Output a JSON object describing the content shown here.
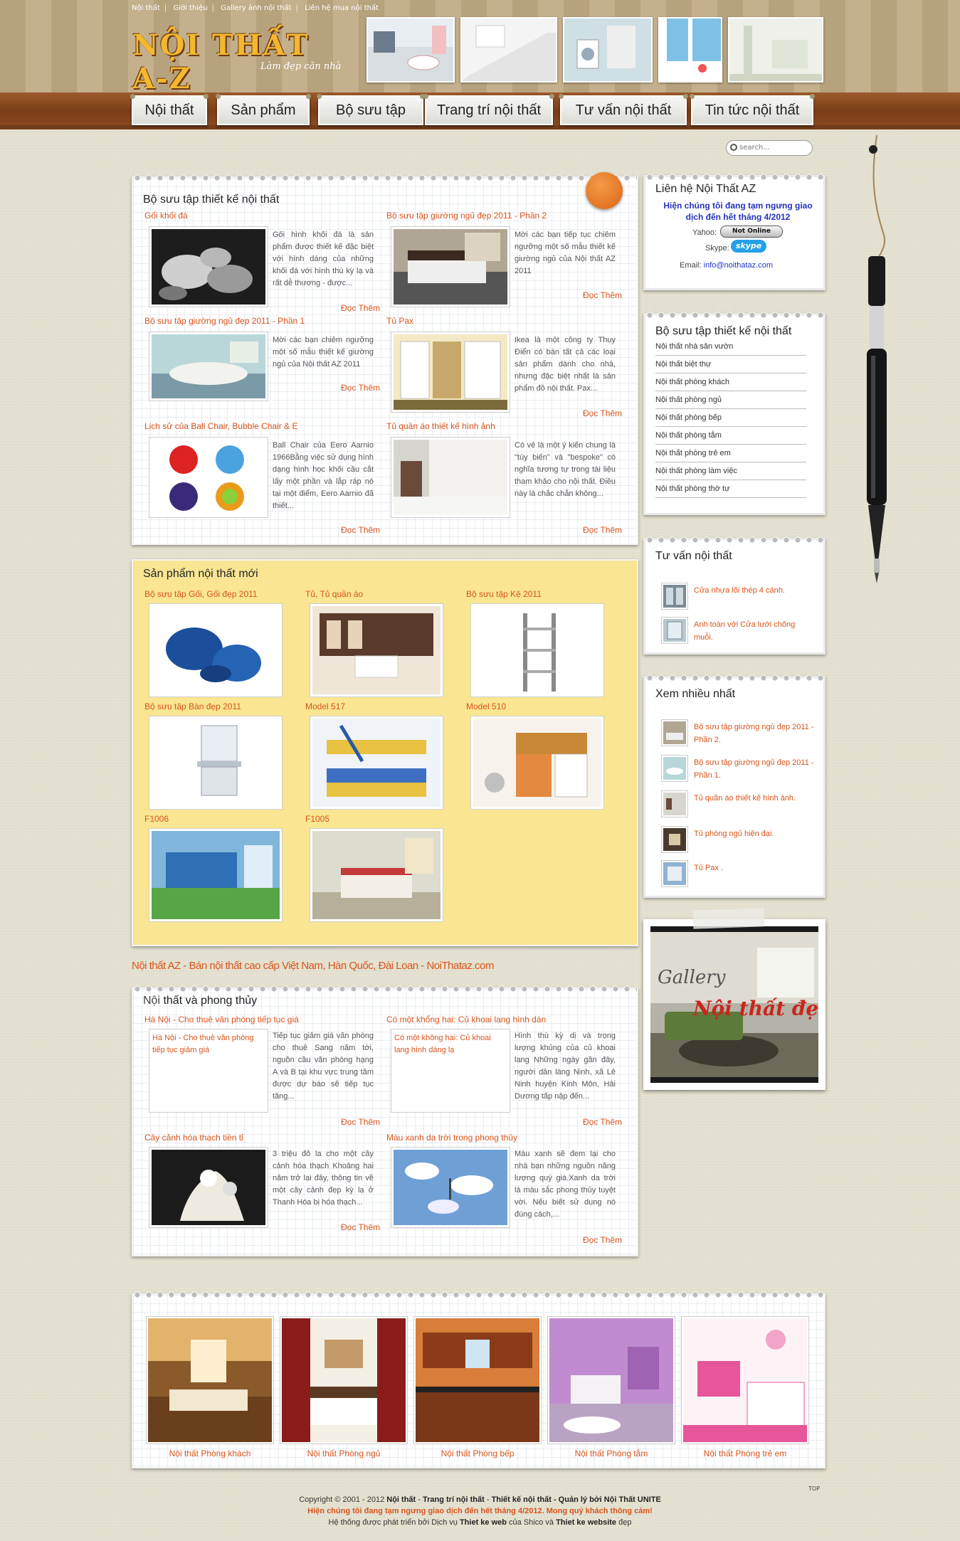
{
  "toplinks": [
    "Nội thất",
    "Giới thiệu",
    "Gallery ảnh nội thất",
    "Liên hệ mua nội thất"
  ],
  "logo": {
    "title": "NỘI THẤT A-Z",
    "slogan": "Làm đẹp căn nhà"
  },
  "nav": [
    "Nội thất",
    "Sản phẩm",
    "Bộ sưu tập",
    "Trang trí nội thất",
    "Tư vấn nội thất",
    "Tin tức nội thất"
  ],
  "search": {
    "placeholder": "search..."
  },
  "collection": {
    "title": "Bộ sưu tập thiết kế nội thất",
    "items": [
      {
        "title": "Gối khối đá",
        "text": "Gối hình khối đá là sản phẩm được thiết kế đặc biệt với hình dáng của những khối đá với hình thù kỳ lạ và rất dễ thương - được...",
        "more": "Đọc Thêm"
      },
      {
        "title": "Bộ sưu tập giường ngủ đẹp 2011 - Phần 2",
        "text": "Mời các bạn tiếp tục chiêm ngưỡng một số mẫu thiết kế giường ngủ của Nội thất AZ 2011",
        "more": "Đọc Thêm"
      },
      {
        "title": "Bộ sưu tập giường ngủ đẹp 2011 - Phần 1",
        "text": "Mời các bạn chiêm ngưỡng một số mẫu thiết kế giường ngủ của Nội thất AZ 2011",
        "more": "Đọc Thêm"
      },
      {
        "title": "Tủ Pax",
        "text": "Ikea là một công ty Thụy Điển có bán tất cả các loại sản phẩm dành cho nhà, nhưng đặc biệt nhất là sản phẩm đồ nội thất. Pax...",
        "more": "Đọc Thêm"
      },
      {
        "title": "Lịch sử của Ball Chair, Bubble Chair & E",
        "text": "Ball Chair của Eero Aarnio 1966Bằng việc sử dụng hình dạng hình học khối cầu cắt lấy một phần và lắp ráp nó tại một điểm, Eero Aarnio đã thiết...",
        "more": "Đọc Thêm"
      },
      {
        "title": "Tủ quần áo thiết kế hình ảnh",
        "text": "Có vẻ là một ý kiến chung là \"tùy biến\" và \"bespoke\" có nghĩa tương tự trong tài liệu tham khảo cho nội thất. Điều này là chắc chắn không...",
        "more": "Đọc Thêm"
      }
    ]
  },
  "products": {
    "title": "Sản phẩm nội thất mới",
    "items": [
      "Bộ sưu tập Gối, Gối đẹp 2011",
      "Tủ, Tủ quần áo",
      "Bộ sưu tập Kệ 2011",
      "Bộ sưu tập Bàn đẹp 2011",
      "Model 517",
      "Model 510",
      "F1006",
      "F1005"
    ]
  },
  "tagline": "Nội thất AZ - Bán nội thất cao cấp Việt Nam, Hàn Quốc, Đài Loan - NoiThataz.com",
  "fengshui": {
    "title_a": "Nội",
    "title_b": " thất và phong thủy",
    "items": [
      {
        "title": "Hà Nội - Cho thuê văn phòng tiếp tục giá",
        "alt": "Hà Nội - Cho thuê văn phòng tiếp tục giảm giá",
        "text": "Tiếp tục giảm giá văn phòng cho thuê Sang năm tới, nguồn cầu văn phòng hạng A và B tại khu vực trung tâm được dự báo sẽ tiếp tục tăng...",
        "more": "Đọc Thêm"
      },
      {
        "title": "Có một khổng hai: Củ khoai lang hình dán",
        "alt": "Có một không hai: Củ khoai lang hình dáng lạ",
        "text": "Hình thù kỳ dị và trọng lượng khủng của củ khoai lang Những ngày gần đây, người dân làng Ninh, xã Lê Ninh huyện Kinh Môn, Hải Dương tấp nập đến...",
        "more": "Đọc Thêm"
      },
      {
        "title": "Cây cảnh hóa thạch tiền tỉ",
        "text": "3 triệu đô la cho một cây cảnh hóa thạch Khoảng hai năm trở lại đây, thông tin về một cây cảnh đẹp kỳ lạ ở Thanh Hóa bị hóa thạch...",
        "more": "Đọc Thêm"
      },
      {
        "title": "Màu xanh da trời trong phong thủy",
        "text": "Màu xanh sẽ đem lại cho nhà bạn những nguồn năng lượng quý giá.Xanh da trời là màu sắc phong thủy tuyệt vời. Nếu biết sử dụng nó đúng cách,...",
        "more": "Đọc Thêm"
      }
    ]
  },
  "contact": {
    "title_a": "Liên",
    "title_b": " hệ Nội Thất AZ",
    "notice": "Hiện chúng tôi đang tạm ngưng giao dịch đến hết tháng 4/2012",
    "yahoo_label": "Yahoo:",
    "yahoo_status": "Not Online",
    "skype_label": "Skype:",
    "skype_badge": "skype",
    "email_label": "Email:",
    "email": "info@noithataz.com"
  },
  "categories": {
    "title_a": "B",
    "title_b": "ộ sưu tập thiết kế nội thất",
    "items": [
      "Nội thất nhà sân vườn",
      "Nội thất biệt thự",
      "Nội thất phòng khách",
      "Nội thất phòng ngủ",
      "Nội thất phòng bếp",
      "Nội thất phòng tắm",
      "Nội thất phòng trẻ em",
      "Nội thất phòng làm việc",
      "Nội thất phòng thờ tự"
    ]
  },
  "advice": {
    "title_a": "T",
    "title_b": "ư vấn nội thất",
    "items": [
      "Cửa nhựa lõi thép 4 cánh.",
      "Anh toàn với Cửa lưới chống muỗi."
    ]
  },
  "popular": {
    "title_a": "Xem",
    "title_b": " nhiều nhất",
    "items": [
      "Bộ sưu tập giường ngủ đẹp 2011 - Phần 2.",
      "Bộ sưu tập giường ngủ đẹp 2011 - Phần 1.",
      "Tủ quần áo thiết kế hình ảnh.",
      "Tủ phòng ngủ hiện đại.",
      "Tủ Pax ."
    ]
  },
  "gallery": {
    "word1": "Gallery",
    "word2": "Nội thất đẹp"
  },
  "bottom": [
    "Nội thất Phòng khách",
    "Nội thất Phòng ngủ",
    "Nội thất Phòng bếp",
    "Nội thất Phòng tắm",
    "Nội thất Phòng trẻ em"
  ],
  "footer": {
    "line1_a": "Copyright © 2001 - 2012 ",
    "line1_b": "Nội thất",
    "line1_c": " - ",
    "line1_d": "Trang trí nội thất",
    "line1_e": " - ",
    "line1_f": "Thiết kế nội thất",
    "line1_g": " - Quản lý bởi Nội Thất UNITE",
    "line2": "Hiện chúng tôi đang tạm ngưng giao dịch đến hết tháng 4/2012. Mong quý khách thông cảm!",
    "line3_a": "Hệ thống được phát triển bởi Dịch vụ ",
    "line3_b": "Thiet ke web",
    "line3_c": " của Shico và ",
    "line3_d": "Thiet ke website",
    "line3_e": " đẹp",
    "top": "TOP"
  },
  "colors": {
    "accent": "#d9541c",
    "link": "#2233cc",
    "wood": "#8d4d22",
    "yellow": "#f9e592"
  }
}
